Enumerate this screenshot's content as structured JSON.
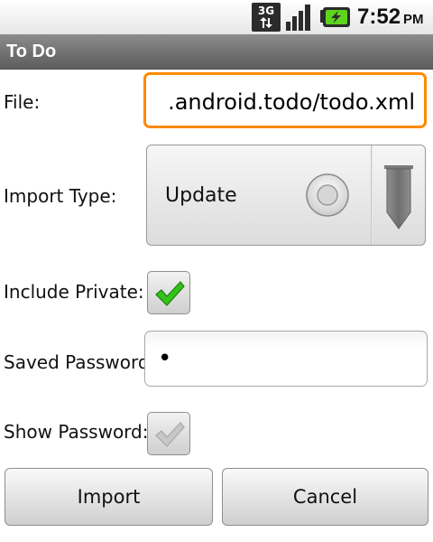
{
  "status_bar": {
    "network": "3G",
    "time": "7:52",
    "ampm": "PM",
    "icons": [
      "3g-data-icon",
      "signal-strength-icon",
      "battery-charging-icon"
    ]
  },
  "title_bar": {
    "title": "To Do"
  },
  "form": {
    "file_label": "File:",
    "file_value": ".android.todo/todo.xml",
    "import_type_label": "Import Type:",
    "import_type_value": "Update",
    "include_private_label": "Include Private:",
    "include_private_checked": true,
    "saved_password_label": "Saved Password:",
    "saved_password_value": "•",
    "show_password_label": "Show Password:",
    "show_password_checked": false
  },
  "buttons": {
    "import_label": "Import",
    "cancel_label": "Cancel"
  },
  "colors": {
    "focus_border": "#ff8a00",
    "check_green": "#33c21a",
    "title_bar": "#6e6e6e",
    "battery_green": "#5fd41f"
  }
}
